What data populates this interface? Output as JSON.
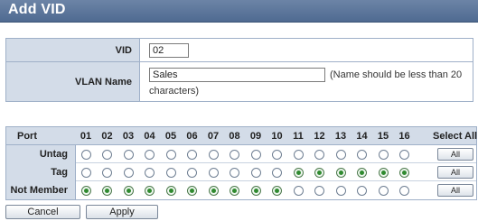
{
  "title": "Add VID",
  "form": {
    "vid_label": "VID",
    "vid_value": "02",
    "vlan_name_label": "VLAN Name",
    "vlan_name_value": "Sales",
    "name_hint_line1": "(Name should be less than 20",
    "name_hint_line2": "characters)"
  },
  "ports": {
    "header_label": "Port",
    "select_all_label": "Select All",
    "columns": [
      "01",
      "02",
      "03",
      "04",
      "05",
      "06",
      "07",
      "08",
      "09",
      "10",
      "11",
      "12",
      "13",
      "14",
      "15",
      "16"
    ],
    "rows": [
      {
        "label": "Untag",
        "selected": [
          false,
          false,
          false,
          false,
          false,
          false,
          false,
          false,
          false,
          false,
          false,
          false,
          false,
          false,
          false,
          false
        ],
        "all_label": "All"
      },
      {
        "label": "Tag",
        "selected": [
          false,
          false,
          false,
          false,
          false,
          false,
          false,
          false,
          false,
          false,
          true,
          true,
          true,
          true,
          true,
          true
        ],
        "all_label": "All"
      },
      {
        "label": "Not Member",
        "selected": [
          true,
          true,
          true,
          true,
          true,
          true,
          true,
          true,
          true,
          true,
          false,
          false,
          false,
          false,
          false,
          false
        ],
        "all_label": "All"
      }
    ]
  },
  "buttons": {
    "cancel": "Cancel",
    "apply": "Apply"
  },
  "colors": {
    "titlebar": "#5a7398",
    "label_bg": "#d3dce8",
    "selected_radio": "#2f8a2f"
  }
}
